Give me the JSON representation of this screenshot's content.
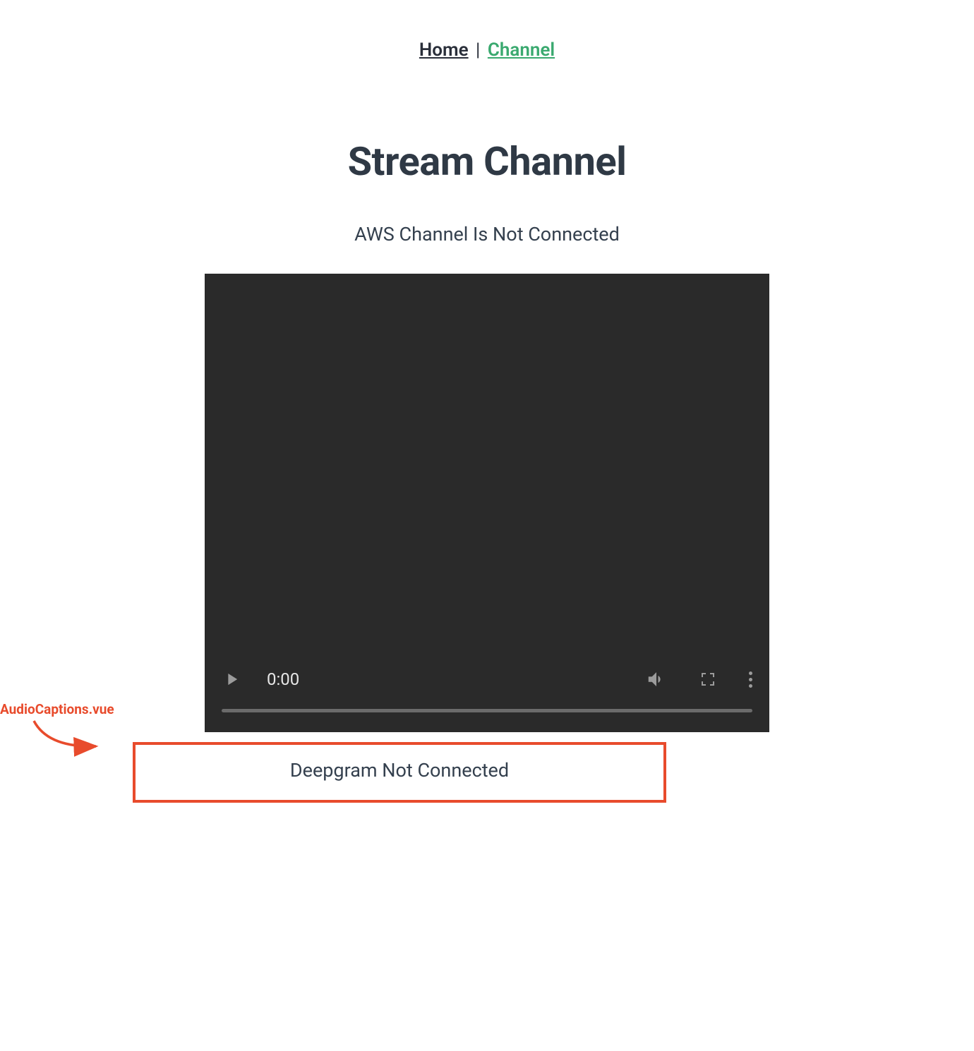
{
  "nav": {
    "home_label": "Home",
    "separator": " | ",
    "channel_label": "Channel"
  },
  "page": {
    "title": "Stream Channel",
    "aws_status": "AWS Channel Is Not Connected"
  },
  "player": {
    "time_display": "0:00"
  },
  "caption": {
    "deepgram_status": "Deepgram Not Connected"
  },
  "annotation": {
    "label": "AudioCaptions.vue"
  },
  "colors": {
    "nav_active": "#3aa96f",
    "text_dark": "#2f3945",
    "highlight_border": "#e84b2c"
  }
}
